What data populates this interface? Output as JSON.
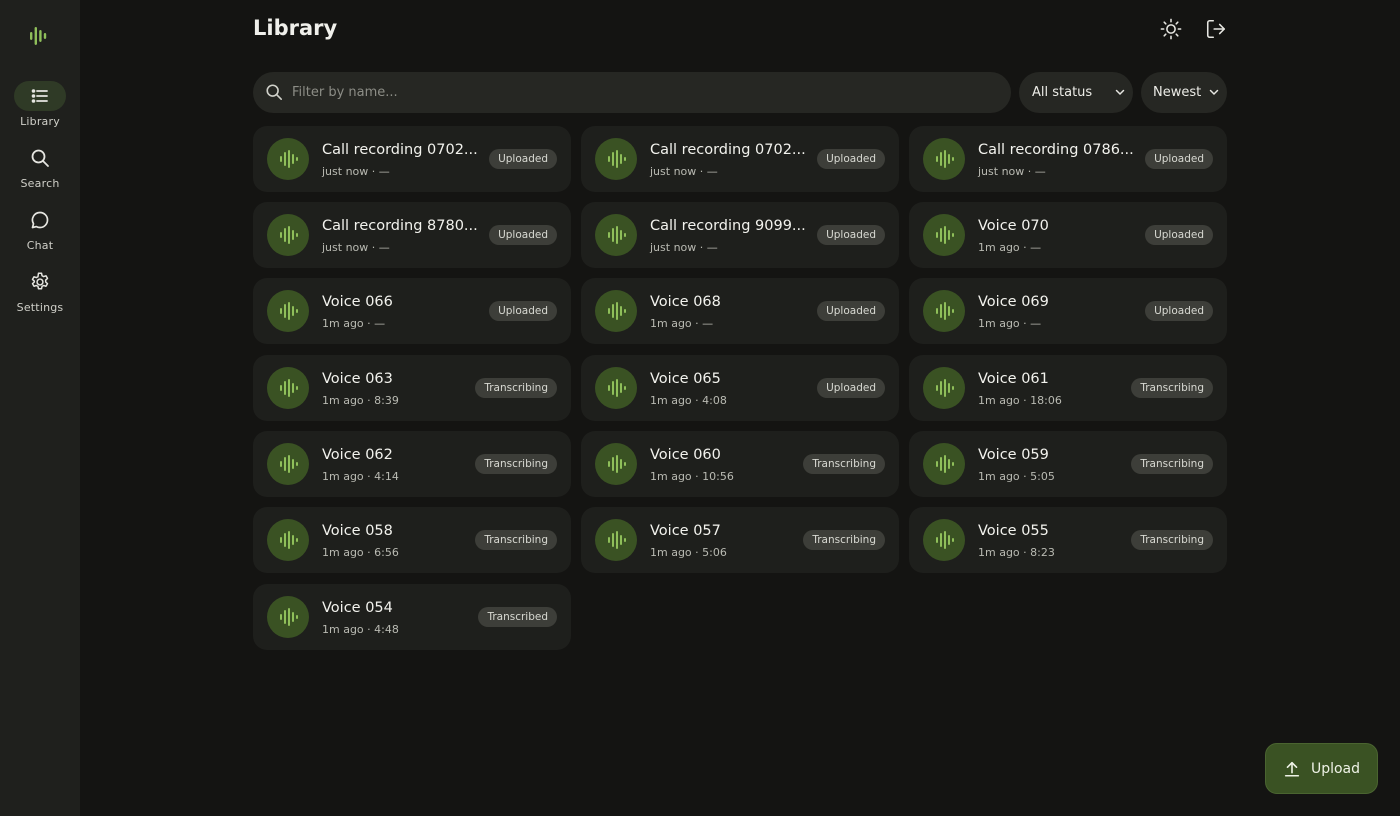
{
  "nav": {
    "items": [
      {
        "id": "library",
        "label": "Library",
        "icon": "list-icon",
        "active": true
      },
      {
        "id": "search",
        "label": "Search",
        "icon": "search-icon",
        "active": false
      },
      {
        "id": "chat",
        "label": "Chat",
        "icon": "chat-bubble-icon",
        "active": false
      },
      {
        "id": "settings",
        "label": "Settings",
        "icon": "gear-icon",
        "active": false
      }
    ]
  },
  "header": {
    "title": "Library",
    "theme_icon": "sun-icon",
    "logout_icon": "logout-icon"
  },
  "filters": {
    "search_placeholder": "Filter by name...",
    "search_value": "",
    "status_selected": "All status",
    "sort_selected": "Newest"
  },
  "recordings": [
    {
      "title": "Call recording 0702...",
      "meta": "just now · —",
      "status": "Uploaded"
    },
    {
      "title": "Call recording 0702...",
      "meta": "just now · —",
      "status": "Uploaded"
    },
    {
      "title": "Call recording 0786...",
      "meta": "just now · —",
      "status": "Uploaded"
    },
    {
      "title": "Call recording 8780...",
      "meta": "just now · —",
      "status": "Uploaded"
    },
    {
      "title": "Call recording 9099...",
      "meta": "just now · —",
      "status": "Uploaded"
    },
    {
      "title": "Voice 070",
      "meta": "1m ago · —",
      "status": "Uploaded"
    },
    {
      "title": "Voice 066",
      "meta": "1m ago · —",
      "status": "Uploaded"
    },
    {
      "title": "Voice 068",
      "meta": "1m ago · —",
      "status": "Uploaded"
    },
    {
      "title": "Voice 069",
      "meta": "1m ago · —",
      "status": "Uploaded"
    },
    {
      "title": "Voice 063",
      "meta": "1m ago · 8:39",
      "status": "Transcribing"
    },
    {
      "title": "Voice 065",
      "meta": "1m ago · 4:08",
      "status": "Uploaded"
    },
    {
      "title": "Voice 061",
      "meta": "1m ago · 18:06",
      "status": "Transcribing"
    },
    {
      "title": "Voice 062",
      "meta": "1m ago · 4:14",
      "status": "Transcribing"
    },
    {
      "title": "Voice 060",
      "meta": "1m ago · 10:56",
      "status": "Transcribing"
    },
    {
      "title": "Voice 059",
      "meta": "1m ago · 5:05",
      "status": "Transcribing"
    },
    {
      "title": "Voice 058",
      "meta": "1m ago · 6:56",
      "status": "Transcribing"
    },
    {
      "title": "Voice 057",
      "meta": "1m ago · 5:06",
      "status": "Transcribing"
    },
    {
      "title": "Voice 055",
      "meta": "1m ago · 8:23",
      "status": "Transcribing"
    },
    {
      "title": "Voice 054",
      "meta": "1m ago · 4:48",
      "status": "Transcribed"
    }
  ],
  "upload": {
    "label": "Upload",
    "icon": "upload-arrow-icon"
  },
  "colors": {
    "accent": "#3a5223",
    "accent_light": "#8fbf5a",
    "background": "#141412",
    "sidebar": "#1f201d",
    "card": "#1e1f1c"
  }
}
